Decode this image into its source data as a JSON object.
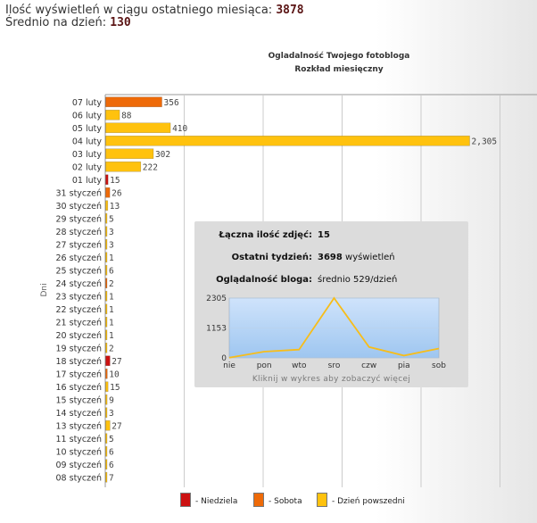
{
  "stats": {
    "views_label": "Ilość wyświetleń w ciągu ostatniego miesiąca:",
    "views_value": "3878",
    "avg_label": "Średnio na dzień:",
    "avg_value": "130"
  },
  "colors": {
    "sunday": "#cc1111",
    "saturday": "#ee6a08",
    "weekday": "#ffc20e",
    "stat_value": "#5a1414",
    "grid": "#cccccc"
  },
  "chart_data": {
    "type": "bar",
    "orientation": "horizontal",
    "title": "Ogladalność Twojego fotobloga",
    "subtitle": "Rozkład miesięczny",
    "ylabel": "Dni",
    "xlim": [
      0,
      2760
    ],
    "grid": true,
    "categories": [
      "07 luty",
      "06 luty",
      "05 luty",
      "04 luty",
      "03 luty",
      "02 luty",
      "01 luty",
      "31 styczeń",
      "30 styczeń",
      "29 styczeń",
      "28 styczeń",
      "27 styczeń",
      "26 styczeń",
      "25 styczeń",
      "24 styczeń",
      "23 styczeń",
      "22 styczeń",
      "21 styczeń",
      "20 styczeń",
      "19 styczeń",
      "18 styczeń",
      "17 styczeń",
      "16 styczeń",
      "15 styczeń",
      "14 styczeń",
      "13 styczeń",
      "11 styczeń",
      "10 styczeń",
      "09 styczeń",
      "08 styczeń"
    ],
    "values": [
      356,
      88,
      410,
      2305,
      302,
      222,
      15,
      26,
      13,
      5,
      3,
      3,
      1,
      6,
      2,
      1,
      1,
      1,
      1,
      2,
      27,
      10,
      15,
      9,
      3,
      27,
      5,
      6,
      6,
      7
    ],
    "value_labels": [
      "356",
      "88",
      "410",
      "2,305",
      "302",
      "222",
      "15",
      "26",
      "13",
      "5",
      "3",
      "3",
      "1",
      "6",
      "2",
      "1",
      "1",
      "1",
      "1",
      "2",
      "27",
      "10",
      "15",
      "9",
      "3",
      "27",
      "5",
      "6",
      "6",
      "7"
    ],
    "day_type": [
      "saturday",
      "weekday",
      "weekday",
      "weekday",
      "weekday",
      "weekday",
      "sunday",
      "saturday",
      "weekday",
      "weekday",
      "weekday",
      "weekday",
      "weekday",
      "weekday",
      "saturday",
      "weekday",
      "weekday",
      "weekday",
      "weekday",
      "weekday",
      "sunday",
      "saturday",
      "weekday",
      "weekday",
      "weekday",
      "weekday",
      "weekday",
      "weekday",
      "weekday",
      "weekday"
    ],
    "legend": [
      {
        "key": "sunday",
        "label": "- Niedziela"
      },
      {
        "key": "saturday",
        "label": "- Sobota"
      },
      {
        "key": "weekday",
        "label": "- Dzień powszedni"
      }
    ]
  },
  "info": {
    "photos_label": "Łączna ilość zdjęć:",
    "photos_value": "15",
    "week_label": "Ostatni tydzień:",
    "week_value": "3698",
    "week_unit": "wyświetleń",
    "blog_label": "Oglądalność bloga:",
    "blog_value": "średnio 529/dzień",
    "mini_chart": {
      "type": "area",
      "categories": [
        "nie",
        "pon",
        "wto",
        "sro",
        "czw",
        "pia",
        "sob"
      ],
      "values": [
        10,
        240,
        320,
        2305,
        420,
        90,
        360
      ],
      "y_ticks": [
        "0",
        "1153",
        "2305"
      ],
      "ylim": [
        0,
        2305
      ],
      "caption": "Kliknij w wykres aby zobaczyć więcej"
    }
  }
}
